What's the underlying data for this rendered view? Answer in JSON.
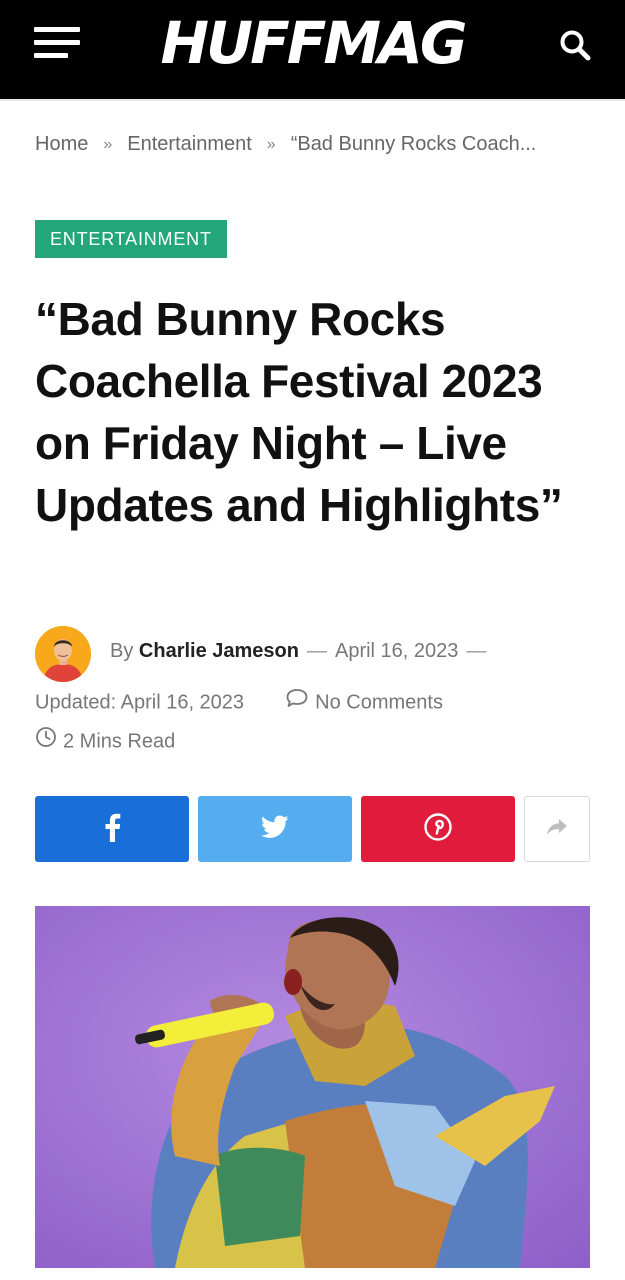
{
  "header": {
    "logo": "HUFFMAG",
    "menu_icon": "hamburger-menu-icon",
    "search_icon": "search-icon"
  },
  "breadcrumb": {
    "home": "Home",
    "section": "Entertainment",
    "current": "“Bad Bunny Rocks Coach...",
    "separator": "»"
  },
  "article": {
    "category": "ENTERTAINMENT",
    "title": "“Bad Bunny Rocks Coachella Festival 2023 on Friday Night – Live Updates and Highlights”",
    "by_label": "By",
    "author": "Charlie Jameson",
    "dash": "—",
    "published": "April 16, 2023",
    "updated_label": "Updated:",
    "updated": "April 16, 2023",
    "comments": "No Comments",
    "read_time": "2 Mins Read"
  },
  "share": {
    "facebook_icon": "facebook-icon",
    "twitter_icon": "twitter-icon",
    "pinterest_icon": "pinterest-icon",
    "more_icon": "share-arrow-icon"
  },
  "colors": {
    "topbar": "#000000",
    "category": "#22a67a",
    "facebook": "#1a6ed8",
    "twitter": "#55acee",
    "pinterest": "#e11b3c"
  }
}
